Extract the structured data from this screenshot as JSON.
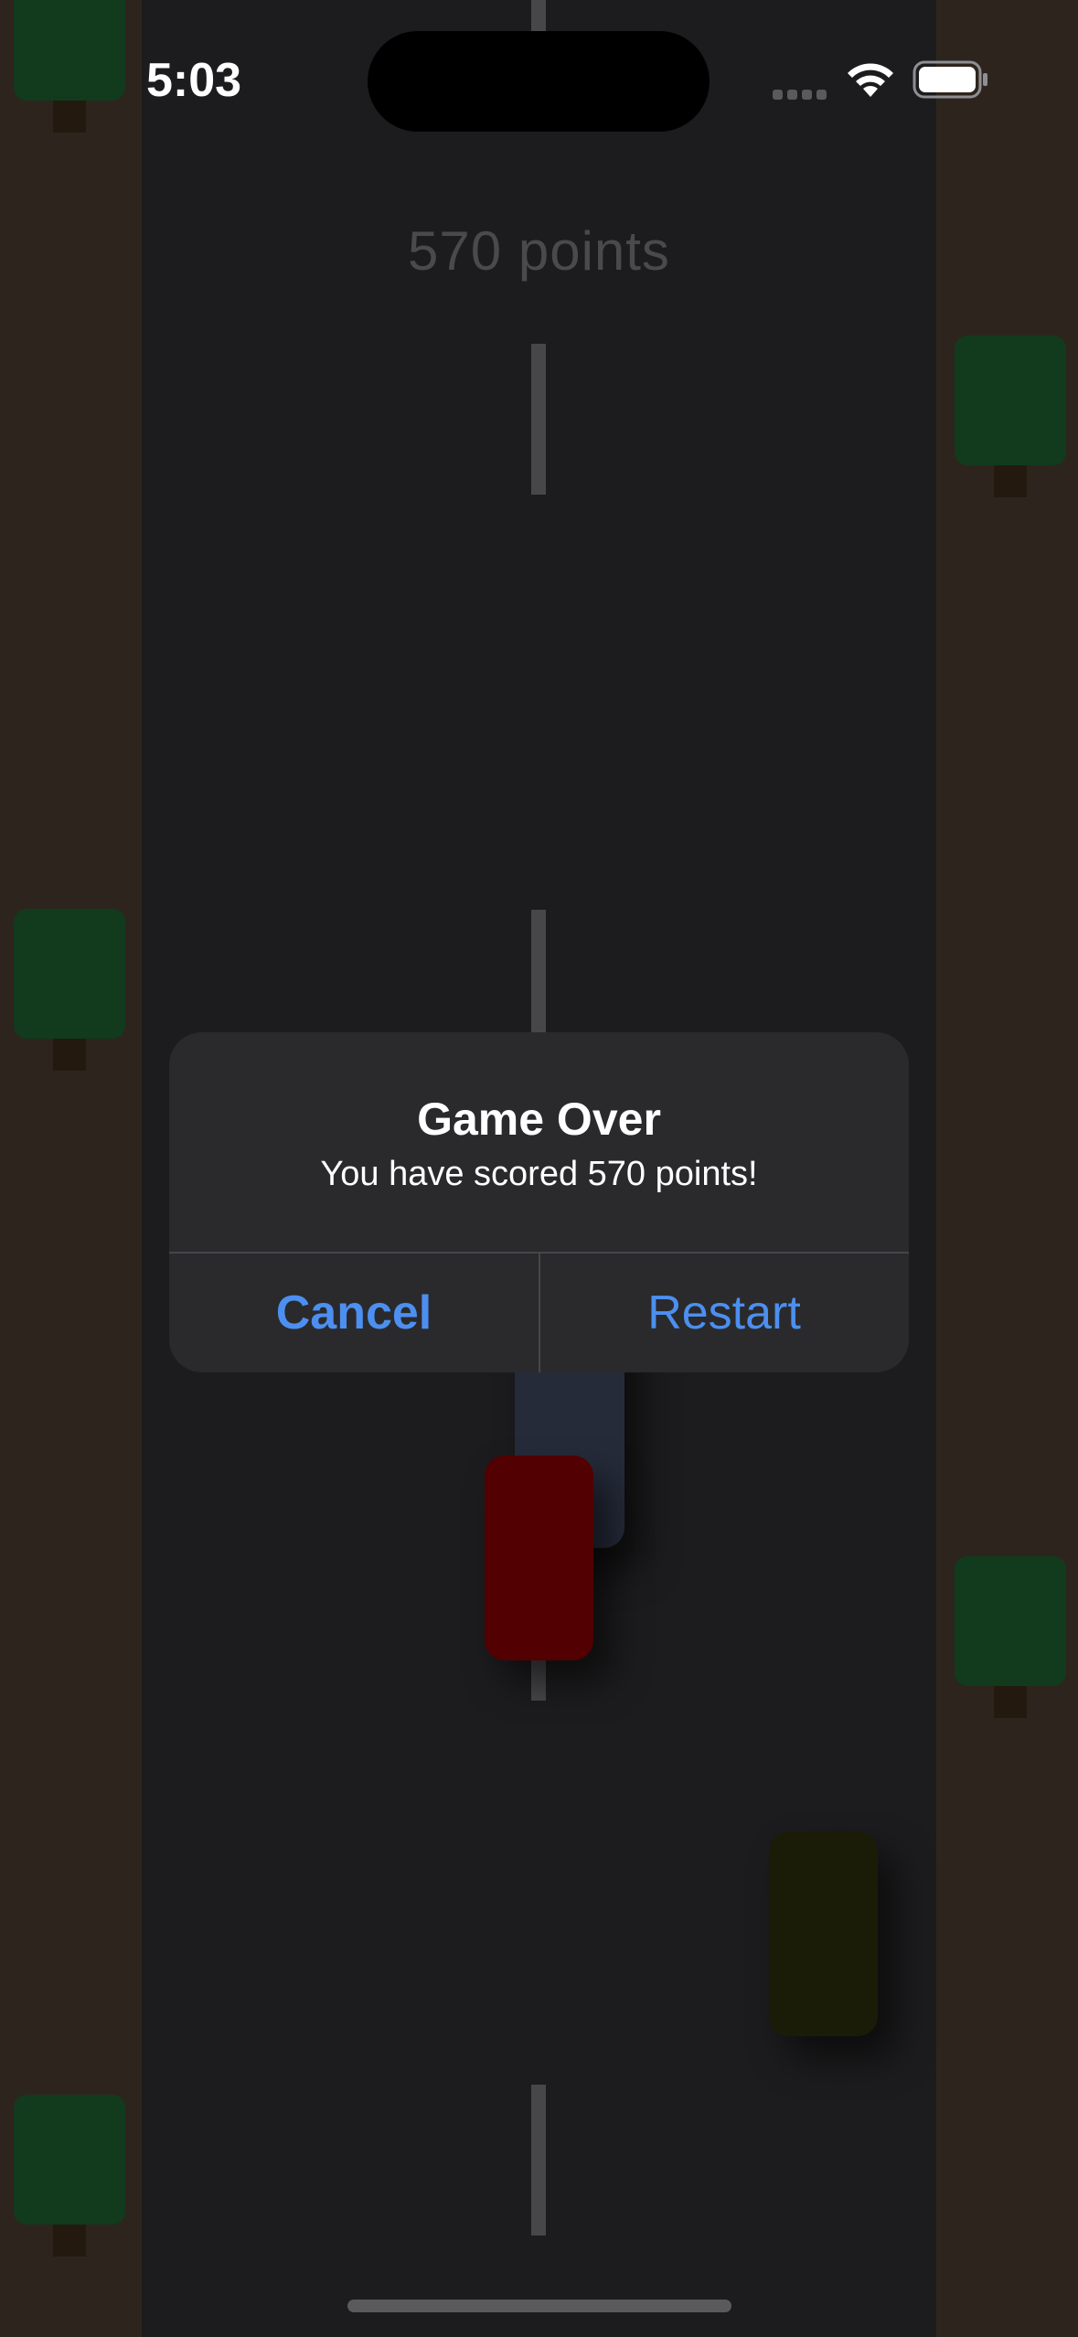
{
  "status_bar": {
    "time": "5:03"
  },
  "game": {
    "score_text": "570 points"
  },
  "alert": {
    "title": "Game Over",
    "message": "You have scored 570 points!",
    "cancel_label": "Cancel",
    "restart_label": "Restart"
  },
  "colors": {
    "road": "#1c1c1e",
    "shoulder": "#2d251d",
    "tree_canopy": "#123a1c",
    "tree_trunk": "#24190f",
    "player_car": "#520002",
    "car_blue": "#262b3a",
    "car_olive": "#1b1c08",
    "alert_bg": "#2a2a2c",
    "alert_button": "#4c8ff0"
  }
}
